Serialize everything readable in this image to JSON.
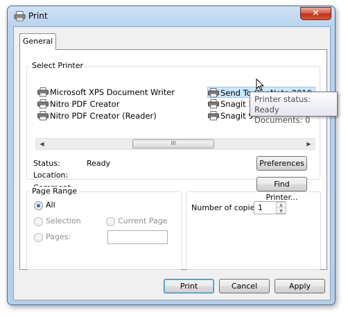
{
  "window": {
    "title": "Print",
    "close_label": "✕"
  },
  "tabs": [
    {
      "label": "General"
    }
  ],
  "select_printer": {
    "legend": "Select Printer",
    "printers": [
      {
        "name": "Microsoft XPS Document Writer",
        "icon": "printer-icon"
      },
      {
        "name": "Nitro PDF Creator",
        "icon": "printer-icon"
      },
      {
        "name": "Nitro PDF Creator (Reader)",
        "icon": "printer-icon"
      },
      {
        "name": "Send To OneNote 2010",
        "icon": "printer-icon",
        "selected": true
      },
      {
        "name": "Snagit 10",
        "icon": "printer-icon"
      },
      {
        "name": "Snagit 9",
        "icon": "printer-icon"
      }
    ],
    "scroll_thumb_grip": "lll",
    "status_label": "Status:",
    "status_value": "Ready",
    "location_label": "Location:",
    "location_value": "",
    "comment_label": "Comment:",
    "comment_value": "",
    "preferences_button": "Preferences",
    "find_printer_button": "Find Printer..."
  },
  "tooltip": {
    "line1": "Printer status: Ready",
    "line2": "Documents: 0"
  },
  "page_range": {
    "legend": "Page Range",
    "all_label": "All",
    "selection_label": "Selection",
    "current_page_label": "Current Page",
    "pages_label": "Pages:",
    "pages_value": "",
    "selected": "All"
  },
  "copies": {
    "label": "Number of copies:",
    "value": "1"
  },
  "buttons": {
    "print": "Print",
    "cancel": "Cancel",
    "apply": "Apply"
  },
  "colors": {
    "selection_bg": "#cce8ff",
    "title_bar": "#b9d3ee",
    "close_button": "#c7432a"
  }
}
